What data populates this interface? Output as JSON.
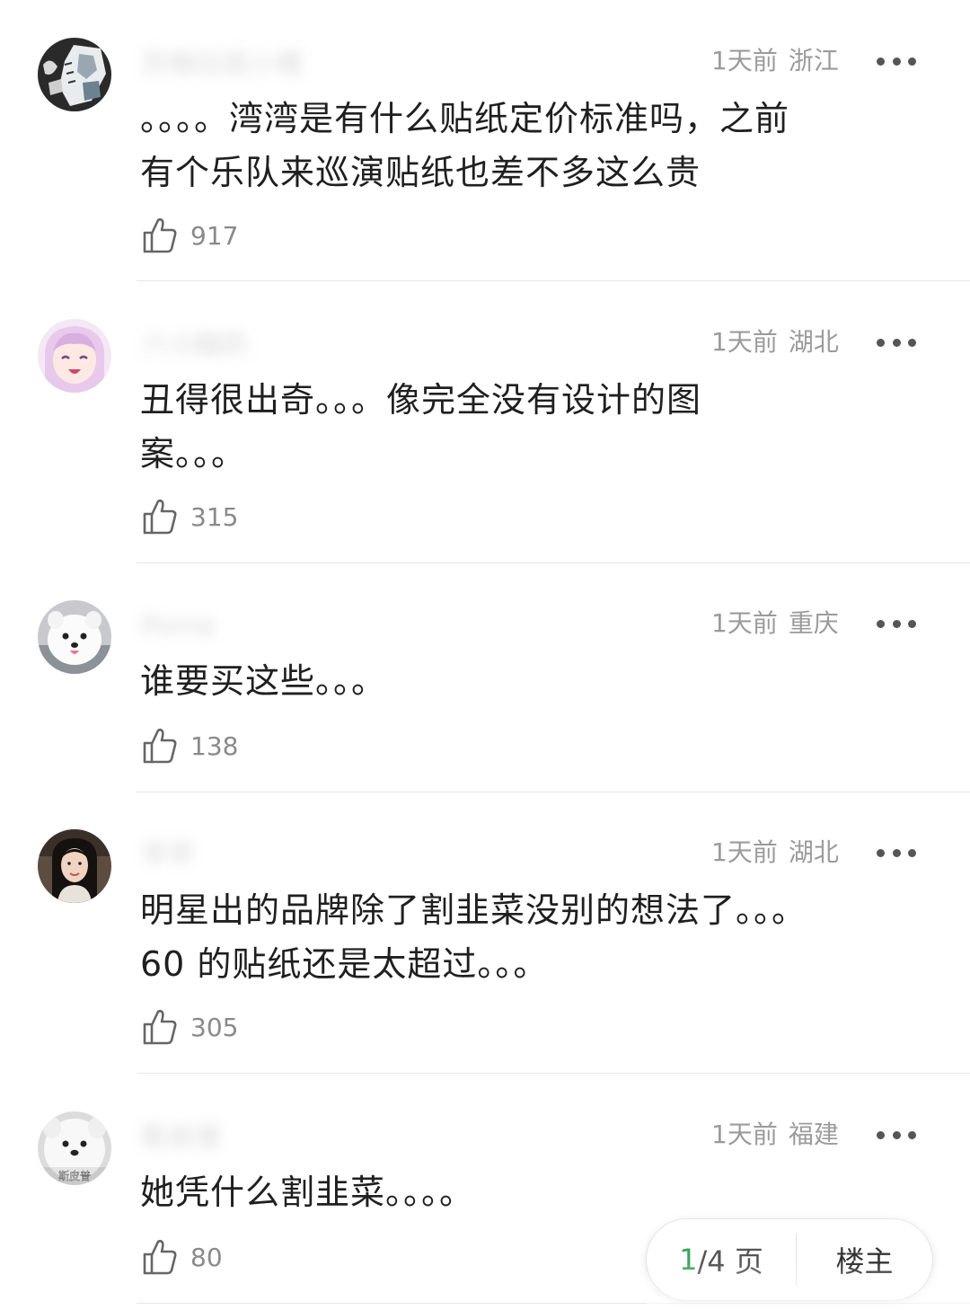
{
  "comments": [
    {
      "username": "苏格拉底小猪",
      "time": "1天前",
      "location": "浙江",
      "text": "。。。。湾湾是有什么贴纸定价标准吗，之前\n有个乐队来巡演贴纸也差不多这么贵",
      "likes": "917",
      "avatar_icon": "anime-sketch-avatar-icon"
    },
    {
      "username": "六斗酸奶",
      "time": "1天前",
      "location": "湖北",
      "text": "丑得很出奇。。。像完全没有设计的图\n案。。。",
      "likes": "315",
      "avatar_icon": "anime-girl-avatar-icon"
    },
    {
      "username": "Pome",
      "time": "1天前",
      "location": "重庆",
      "text": "谁要买这些。。。",
      "likes": "138",
      "avatar_icon": "white-dog-avatar-icon"
    },
    {
      "username": "苹苹",
      "time": "1天前",
      "location": "湖北",
      "text": "明星出的品牌除了割韭菜没别的想法了。。。\n60 的贴纸还是太超过。。。",
      "likes": "305",
      "avatar_icon": "woman-portrait-avatar-icon"
    },
    {
      "username": "斯皮普",
      "time": "1天前",
      "location": "福建",
      "text": "她凭什么割韭菜。。。。",
      "likes": "80",
      "avatar_icon": "samoyed-dog-avatar-icon",
      "avatar_caption": "斯皮普"
    }
  ],
  "pager": {
    "current": "1",
    "total": "/4 页",
    "owner_label": "楼主"
  },
  "colors": {
    "accent": "#3ba55c",
    "meta": "#9b9b9b",
    "text": "#1f1f1f"
  }
}
